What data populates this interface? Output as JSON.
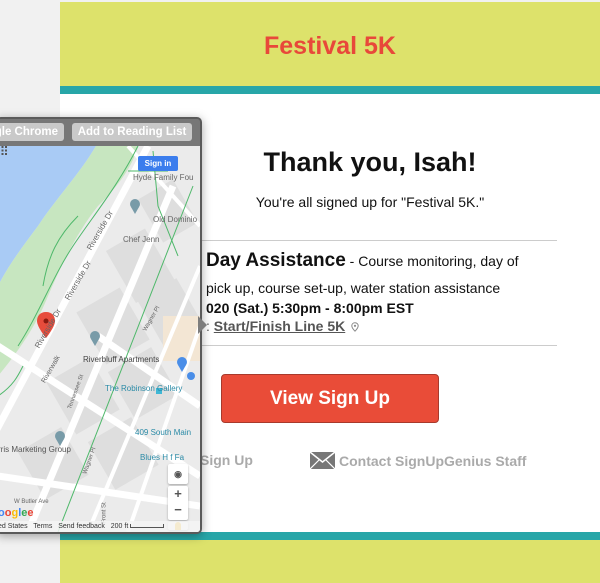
{
  "header": {
    "title": "Festival 5K"
  },
  "colors": {
    "band": "#dde26b",
    "teal": "#27a6a8",
    "accent": "#e94c38",
    "title_red": "#e8483a"
  },
  "confirmation": {
    "heading": "Thank you, Isah!",
    "subline": "You're all signed up for \"Festival 5K.\""
  },
  "slot": {
    "name": "Day Assistance",
    "description_part1": " - Course monitoring, day of",
    "description_part2": "pick up, course set-up, water station assistance",
    "datetime": "020 (Sat.) 5:30pm - 8:00pm EST",
    "location_prefix": ": ",
    "location": "Start/Finish Line 5K",
    "location_icon": "map-pin-icon"
  },
  "actions": {
    "view_button": "View Sign Up",
    "left_link": "Sign Up",
    "contact_link": "Contact SignUpGenius Staff",
    "contact_icon": "envelope-icon"
  },
  "popover": {
    "toolbar_buttons": [
      "gle Chrome",
      "Add to Reading List"
    ],
    "map": {
      "sign_in": "Sign in",
      "labels": {
        "hyde": "Hyde Family Fou",
        "old_dominion": "Old Dominio",
        "chef_jenn": "Chef Jenn",
        "riverside_dr_1": "Riverside Dr",
        "riverside_dr_2": "Riverside Dr",
        "riverside_dr_3": "Riverside Dr",
        "riverwalk": "Riverwalk",
        "riverbluff": "Riverbluff Apartments",
        "tennessee": "Tennessee St",
        "wagner_1": "Wagner Pl",
        "wagner_2": "Wagner Pl",
        "robinson": "The Robinson Gallery",
        "south_main": "409 South Main",
        "marketing": "rris Marketing Group",
        "blues": "Blues H  f Fa",
        "butler": "W Butler Ave",
        "front": "Front St",
        "neely": "Ne     Ave"
      },
      "controls": {
        "zoom_in": "+",
        "zoom_out": "−"
      },
      "google": [
        "G",
        "o",
        "o",
        "g",
        "l",
        "e"
      ],
      "footer": {
        "region": "ed States",
        "terms": "Terms",
        "feedback": "Send feedback",
        "scale": "200 ft"
      }
    }
  }
}
